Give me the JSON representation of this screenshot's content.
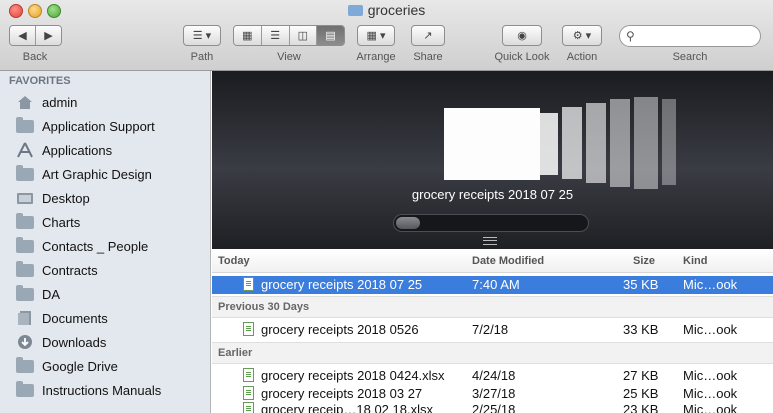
{
  "window": {
    "title": "groceries"
  },
  "toolbar": {
    "back_label": "Back",
    "path_label": "Path",
    "view_label": "View",
    "arrange_label": "Arrange",
    "share_label": "Share",
    "quicklook_label": "Quick Look",
    "action_label": "Action",
    "search_label": "Search",
    "search_placeholder": ""
  },
  "sidebar": {
    "header": "FAVORITES",
    "items": [
      {
        "label": "admin",
        "icon": "home-icon"
      },
      {
        "label": "Application Support",
        "icon": "folder-icon"
      },
      {
        "label": "Applications",
        "icon": "applications-icon"
      },
      {
        "label": "Art Graphic Design",
        "icon": "folder-icon"
      },
      {
        "label": "Desktop",
        "icon": "desktop-icon"
      },
      {
        "label": "Charts",
        "icon": "folder-icon"
      },
      {
        "label": "Contacts _ People",
        "icon": "folder-icon"
      },
      {
        "label": "Contracts",
        "icon": "folder-icon"
      },
      {
        "label": "DA",
        "icon": "folder-icon"
      },
      {
        "label": "Documents",
        "icon": "documents-icon"
      },
      {
        "label": "Downloads",
        "icon": "downloads-icon"
      },
      {
        "label": "Google Drive",
        "icon": "folder-icon"
      },
      {
        "label": "Instructions Manuals",
        "icon": "folder-icon"
      }
    ]
  },
  "coverflow": {
    "caption": "grocery receipts 2018 07 25"
  },
  "list": {
    "columns": {
      "name": "Today",
      "date": "Date Modified",
      "size": "Size",
      "kind": "Kind"
    },
    "today_rows": [
      {
        "name": "grocery receipts 2018 07 25",
        "date": "7:40 AM",
        "size": "35 KB",
        "kind": "Mic…ook"
      }
    ],
    "group_prev30": "Previous 30 Days",
    "prev30_rows": [
      {
        "name": "grocery receipts 2018 0526",
        "date": "7/2/18",
        "size": "33 KB",
        "kind": "Mic…ook"
      }
    ],
    "group_earlier": "Earlier",
    "earlier_rows": [
      {
        "name": "grocery receipts 2018 0424.xlsx",
        "date": "4/24/18",
        "size": "27 KB",
        "kind": "Mic…ook"
      },
      {
        "name": "grocery receipts 2018 03 27",
        "date": "3/27/18",
        "size": "25 KB",
        "kind": "Mic…ook"
      },
      {
        "name": "grocery receip…18 02 18.xlsx",
        "date": "2/25/18",
        "size": "23 KB",
        "kind": "Mic…ook"
      }
    ]
  }
}
